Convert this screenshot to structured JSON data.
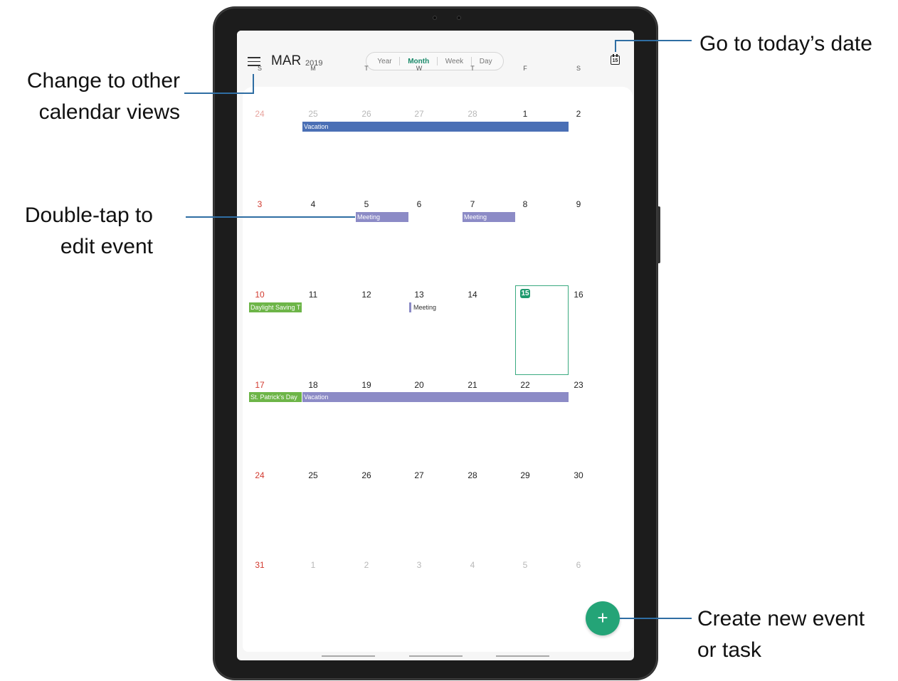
{
  "header": {
    "month": "MAR",
    "year": "2019",
    "views": [
      "Year",
      "Month",
      "Week",
      "Day"
    ],
    "active_view": "Month",
    "today_icon_number": "15"
  },
  "weekdays": [
    "S",
    "M",
    "T",
    "W",
    "T",
    "F",
    "S"
  ],
  "weeks": [
    [
      "24",
      "25",
      "26",
      "27",
      "28",
      "1",
      "2"
    ],
    [
      "3",
      "4",
      "5",
      "6",
      "7",
      "8",
      "9"
    ],
    [
      "10",
      "11",
      "12",
      "13",
      "14",
      "15",
      "16"
    ],
    [
      "17",
      "18",
      "19",
      "20",
      "21",
      "22",
      "23"
    ],
    [
      "24",
      "25",
      "26",
      "27",
      "28",
      "29",
      "30"
    ],
    [
      "31",
      "1",
      "2",
      "3",
      "4",
      "5",
      "6"
    ]
  ],
  "today": "15",
  "events": {
    "vacation_1": "Vacation",
    "meeting_tue": "Meeting",
    "meeting_thu": "Meeting",
    "daylight_saving": "Daylight Saving T",
    "meeting_wed": "Meeting",
    "st_patricks": "St. Patrick's Day",
    "vacation_2": "Vacation"
  },
  "fab_symbol": "+",
  "callouts": {
    "calendar_views_line1": "Change to other",
    "calendar_views_line2": "calendar views",
    "edit_event_line1": "Double-tap to",
    "edit_event_line2": "edit event",
    "today_date": "Go to today’s date",
    "new_event_line1": "Create new event",
    "new_event_line2": "or task"
  },
  "colors": {
    "accent": "#1f9a6e",
    "sunday": "#d23a2f",
    "vacation": "#4a6fb5",
    "meeting": "#8c8bc6",
    "holiday": "#6db548",
    "callout_line": "#2f6ea3"
  }
}
